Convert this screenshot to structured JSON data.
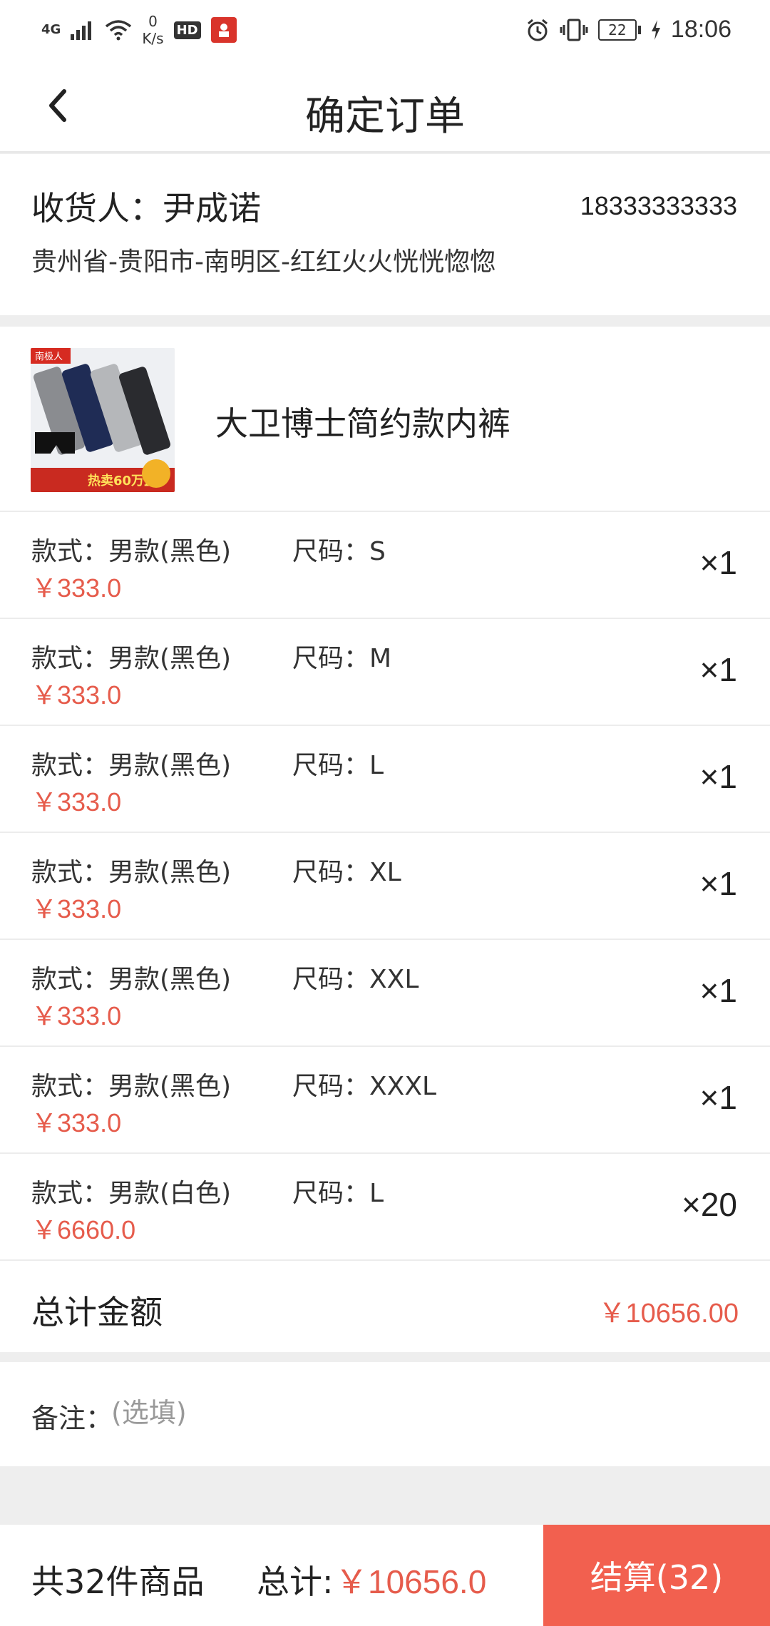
{
  "status_bar": {
    "network": "4G",
    "speed_value": "0",
    "speed_unit": "K/s",
    "hd": "HD",
    "battery": "22",
    "time": "18:06"
  },
  "header": {
    "title": "确定订单",
    "back_icon": "chevron-left-icon"
  },
  "address": {
    "recipient": "收货人：尹成诺",
    "phone": "18333333333",
    "line": "贵州省-贵阳市-南明区-红红火火恍恍惚惚"
  },
  "product": {
    "name": "大卫博士简约款内裤",
    "image_brand": "南极人",
    "image_promo": "热卖60万盒"
  },
  "variants": [
    {
      "style": "款式：男款(黑色)",
      "size": "尺码：S",
      "price": "￥333.0",
      "qty": "×1"
    },
    {
      "style": "款式：男款(黑色)",
      "size": "尺码：M",
      "price": "￥333.0",
      "qty": "×1"
    },
    {
      "style": "款式：男款(黑色)",
      "size": "尺码：L",
      "price": "￥333.0",
      "qty": "×1"
    },
    {
      "style": "款式：男款(黑色)",
      "size": "尺码：XL",
      "price": "￥333.0",
      "qty": "×1"
    },
    {
      "style": "款式：男款(黑色)",
      "size": "尺码：XXL",
      "price": "￥333.0",
      "qty": "×1"
    },
    {
      "style": "款式：男款(黑色)",
      "size": "尺码：XXXL",
      "price": "￥333.0",
      "qty": "×1"
    },
    {
      "style": "款式：男款(白色)",
      "size": "尺码：L",
      "price": "￥6660.0",
      "qty": "×20"
    }
  ],
  "total": {
    "label": "总计金额",
    "amount": "￥10656.00"
  },
  "remark": {
    "label": "备注：",
    "placeholder": "(选填)"
  },
  "footer": {
    "item_count": "共32件商品",
    "sum_label": "总计:",
    "sum_value": "￥10656.0",
    "checkout_label": "结算(32)"
  },
  "colors": {
    "accent": "#f2604f",
    "price": "#e65c4c",
    "divider": "#eeeeee"
  }
}
